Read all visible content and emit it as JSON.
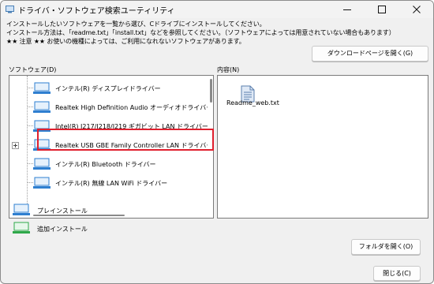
{
  "window": {
    "title": "ドライバ・ソフトウェア検索ユーティリティ",
    "minimize_icon": "minimize-icon",
    "maximize_icon": "maximize-icon",
    "close_icon": "close-icon"
  },
  "intro": {
    "line1": "インストールしたいソフトウェアを一覧から選び、Cドライブにインストールしてください。",
    "line2": "インストール方法は、「readme.txt」「install.txt」などを参照してください。（ソフトウェアによっては用意されていない場合もあります）",
    "line3": "★★ 注意 ★★ お使いの機種によっては、ご利用になれないソフトウェアがあります。"
  },
  "download_button": {
    "label": "ダウンロードページを開く(G)"
  },
  "software": {
    "label": "ソフトウェア(D)",
    "items": [
      {
        "label": "インテル(R) ディスプレイドライバー",
        "icon": "installed-software-icon",
        "expandable": false
      },
      {
        "label": "Realtek High Definition Audio オーディオドライバー",
        "icon": "installed-software-icon",
        "expandable": false
      },
      {
        "label": "Intel(R) I217/I218/I219 ギガビット LAN ドライバー",
        "icon": "installed-software-icon",
        "expandable": false
      },
      {
        "label": "Realtek USB GBE Family Controller LAN ドライバー",
        "icon": "installed-software-icon",
        "expandable": true
      },
      {
        "label": "インテル(R) Bluetooth ドライバー",
        "icon": "installed-software-icon",
        "expandable": false
      },
      {
        "label": "インテル(R) 無線 LAN WiFi ドライバー",
        "icon": "installed-software-icon",
        "expandable": false
      }
    ]
  },
  "contents": {
    "label": "内容(N)",
    "files": [
      {
        "name": "Readme_web.txt",
        "icon": "text-file-icon"
      }
    ]
  },
  "legend": {
    "preinstalled": {
      "label": "プレインストール",
      "icon": "preinstall-icon"
    },
    "additional": {
      "label": "追加インストール",
      "icon": "additional-install-icon"
    }
  },
  "open_folder_button": {
    "label": "フォルダを開く(O)"
  },
  "close_button": {
    "label": "閉じる(C)"
  },
  "colors": {
    "window_bg": "#f0f0f0",
    "highlight_border": "#e0202e",
    "preinstall_icon": "#2f7fd0",
    "additional_icon": "#2fa84a"
  }
}
